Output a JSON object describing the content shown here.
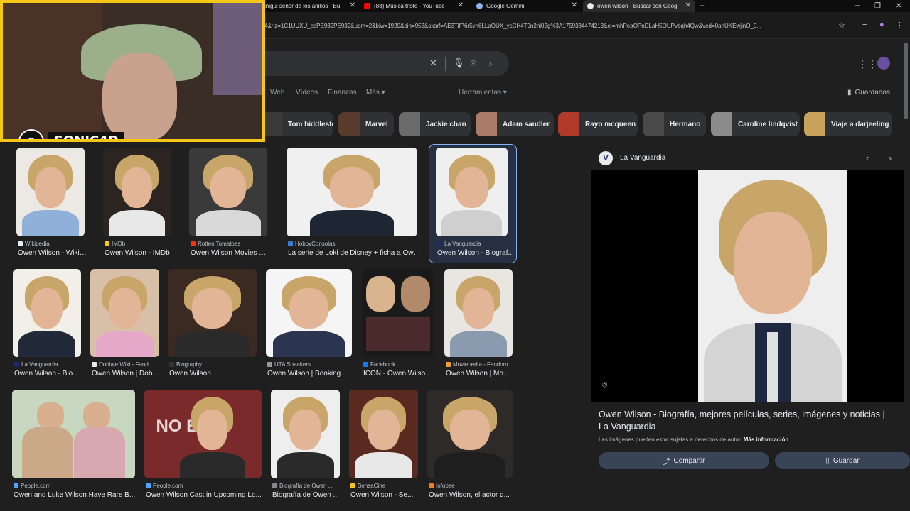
{
  "browser": {
    "tabs": [
      {
        "label": "inigul señor de los anillos - Bu",
        "favicon_color": "#4285f4"
      },
      {
        "label": "(88) Música triste - YouTube",
        "favicon_color": "#ff0000"
      },
      {
        "label": "Google Gemini",
        "favicon_color": "#8ab4f8"
      },
      {
        "label": "owen wilson - Buscar con Goog",
        "favicon_color": "#e8eaed"
      }
    ],
    "new_tab": "+",
    "url": "4&rlz=1C1UUXU_esPE932PE932&udm=2&biw=1920&bih=953&sxsrf=AE3TifP6r5vh6LLaOUX_ycCH4T9n2nl02g%3A1759384474213&ei=mhPeaOPnDLaH5OUPvbqh4Qw&ved=0ahUKEwjjnO_0..."
  },
  "webcam": {
    "channel_name": "SONIC4D",
    "logo_glyph": "⊘"
  },
  "search": {
    "query": "",
    "clear_icon": "✕",
    "voice_icon": "🎙",
    "lens_icon": "⌾",
    "search_icon": "⌕"
  },
  "nav": {
    "tabs": [
      "Web",
      "Vídeos",
      "Finanzas",
      "Más ▾"
    ],
    "tools": "Herramientas ▾",
    "saved": "Guardados"
  },
  "chips": [
    {
      "label": "Tom hiddleston",
      "color": "#3a3a3a"
    },
    {
      "label": "Marvel",
      "color": "#5a3c2c"
    },
    {
      "label": "Jackie chan",
      "color": "#6b6b6b"
    },
    {
      "label": "Adam sandler",
      "color": "#a87c66"
    },
    {
      "label": "Rayo mcqueen",
      "color": "#b23a2a"
    },
    {
      "label": "Hermano",
      "color": "#4a4a4a"
    },
    {
      "label": "Caroline lindqvist",
      "color": "#8c8c8c"
    },
    {
      "label": "Viaje a darjeeling",
      "color": "#c9a35a"
    }
  ],
  "results": [
    {
      "source": "Wikipedia",
      "caption": "Owen Wilson - Wikipe...",
      "fav": "#e8eaed"
    },
    {
      "source": "IMDb",
      "caption": "Owen Wilson - IMDb",
      "fav": "#f5c518"
    },
    {
      "source": "Rotten Tomatoes",
      "caption": "Owen Wilson Movies & ...",
      "fav": "#fa320a"
    },
    {
      "source": "HobbyConsolas",
      "caption": "La serie de Loki de Disney + ficha a Owen ...",
      "fav": "#3a7bd5"
    },
    {
      "source": "La Vanguardia",
      "caption": "Owen Wilson - Biograf...",
      "fav": "#1a2a6c"
    },
    {
      "source": "La Vanguardia",
      "caption": "Owen Wilson - Bio...",
      "fav": "#1a2a6c"
    },
    {
      "source": "Doblaje Wiki - Fand...",
      "caption": "Owen Wilson | Dob...",
      "fav": "#e8eaed"
    },
    {
      "source": "Biography",
      "caption": "Owen Wilson",
      "fav": "#333"
    },
    {
      "source": "UTA Speakers",
      "caption": "Owen Wilson | Booking ...",
      "fav": "#999"
    },
    {
      "source": "Facebook",
      "caption": "ICON - Owen Wilso...",
      "fav": "#1877f2"
    },
    {
      "source": "Moviepedia - Fandom",
      "caption": "Owen Wilson | Mo...",
      "fav": "#f0a030"
    },
    {
      "source": "People.com",
      "caption": "Owen and Luke Wilson Have Rare B...",
      "fav": "#4da3ff"
    },
    {
      "source": "People.com",
      "caption": "Owen Wilson Cast in Upcoming Lo...",
      "fav": "#4da3ff"
    },
    {
      "source": "Biografía de Owen ...",
      "caption": "Biografía de Owen ...",
      "fav": "#888"
    },
    {
      "source": "SensaCine",
      "caption": "Owen Wilson - Se...",
      "fav": "#f5c518"
    },
    {
      "source": "Infobae",
      "caption": "Owen Wilson, el actor q...",
      "fav": "#f47c20"
    }
  ],
  "panel": {
    "source_name": "La Vanguardia",
    "source_initial": "V",
    "title": "Owen Wilson - Biografía, mejores películas, series, imágenes y noticias | La Vanguardia",
    "note": "Las imágenes pueden estar sujetas a derechos de autor.",
    "more_info": "Más información",
    "share_label": "Compartir",
    "save_label": "Guardar",
    "prev_icon": "‹",
    "next_icon": "›"
  }
}
